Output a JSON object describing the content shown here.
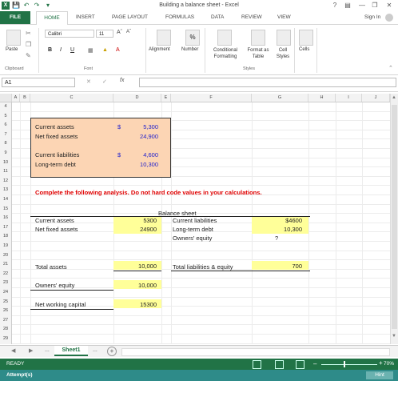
{
  "app": {
    "title": "Building a balance sheet - Excel",
    "logo": "X",
    "help": "?",
    "sign_in": "Sign In"
  },
  "ribbon_tabs": [
    "FILE",
    "HOME",
    "INSERT",
    "PAGE LAYOUT",
    "FORMULAS",
    "DATA",
    "REVIEW",
    "VIEW"
  ],
  "ribbon": {
    "paste": "Paste",
    "font_name": "Calibri",
    "font_size": "11",
    "bold": "B",
    "italic": "I",
    "underline": "U",
    "alignment": "Alignment",
    "number": "Number",
    "percent": "%",
    "conditional_formatting": "Conditional Formatting",
    "format_as_table": "Format as Table",
    "cell_styles": "Cell Styles",
    "cells": "Cells",
    "groups": {
      "clipboard": "Clipboard",
      "font": "Font",
      "styles": "Styles"
    }
  },
  "formula_bar": {
    "name_box": "A1",
    "fx": "fx",
    "value": ""
  },
  "columns": [
    "A",
    "B",
    "C",
    "D",
    "E",
    "F",
    "G",
    "H",
    "I",
    "J"
  ],
  "rows": [
    "4",
    "5",
    "6",
    "7",
    "8",
    "9",
    "10",
    "11",
    "12",
    "13",
    "14",
    "15",
    "16",
    "17",
    "18",
    "19",
    "20",
    "21",
    "22",
    "23",
    "24",
    "25",
    "26",
    "27",
    "28",
    "29"
  ],
  "given": {
    "current_assets_label": "Current assets",
    "current_assets_sign": "$",
    "current_assets_value": "5,300",
    "net_fixed_assets_label": "Net fixed assets",
    "net_fixed_assets_value": "24,900",
    "current_liabilities_label": "Current liabilities",
    "current_liabilities_sign": "$",
    "current_liabilities_value": "4,600",
    "long_term_debt_label": "Long-term debt",
    "long_term_debt_value": "10,300"
  },
  "instruction": "Complete the following analysis. Do not hard code values in your calculations.",
  "balance_sheet": {
    "title": "Balance sheet",
    "current_assets_label": "Current assets",
    "current_assets_value": "5300",
    "net_fixed_assets_label": "Net fixed assets",
    "net_fixed_assets_value": "24900",
    "current_liabilities_label": "Current liabilities",
    "current_liabilities_value": "$4600",
    "long_term_debt_label": "Long-term debt",
    "long_term_debt_value": "10,300",
    "owners_equity_label": "Owners' equity",
    "owners_equity_value": "?",
    "total_assets_label": "Total assets",
    "total_assets_value": "10,000",
    "total_liab_equity_label": "Total liabilities & equity",
    "total_liab_equity_value": "700",
    "owners_equity2_label": "Owners' equity",
    "owners_equity2_value": "10,000",
    "nwc_label": "Net working capital",
    "nwc_value": "15300"
  },
  "sheets": {
    "active": "Sheet1",
    "ellipsis": "...",
    "add": "+"
  },
  "status": {
    "ready": "READY",
    "zoom": "70%"
  },
  "attempt": {
    "label": "Attempt(s)",
    "hint": "Hint"
  },
  "colors": {
    "excel_green": "#217346",
    "given_box": "#fcd5b4",
    "input_yellow": "#ffff99",
    "instruction_red": "#e00000",
    "value_blue": "#2222cc"
  }
}
